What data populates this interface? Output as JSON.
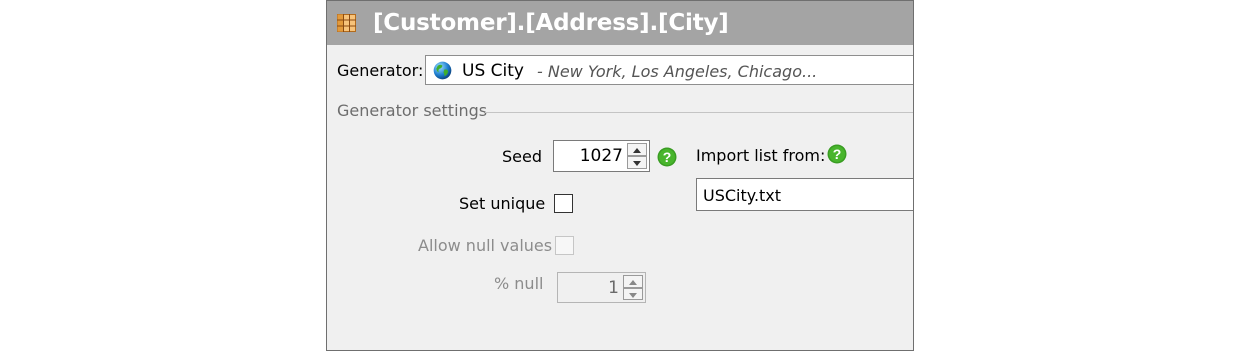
{
  "header": {
    "title": "[Customer].[Address].[City]",
    "icon": "table-grid-icon"
  },
  "generator": {
    "label": "Generator:",
    "name": "US City",
    "description": "- New York, Los Angeles, Chicago...",
    "icon": "globe-icon"
  },
  "settings": {
    "section_label": "Generator settings",
    "seed": {
      "label": "Seed",
      "value": "1027"
    },
    "set_unique": {
      "label": "Set unique",
      "checked": false
    },
    "allow_null": {
      "label": "Allow null values",
      "checked": false,
      "enabled": false
    },
    "percent_null": {
      "label": "% null",
      "value": "1",
      "enabled": false
    },
    "import_list": {
      "label": "Import list from:",
      "value": "USCity.txt"
    }
  },
  "colors": {
    "titlebar": "#a4a4a4",
    "help_green": "#3a9d23",
    "panel": "#f0f0f0"
  }
}
